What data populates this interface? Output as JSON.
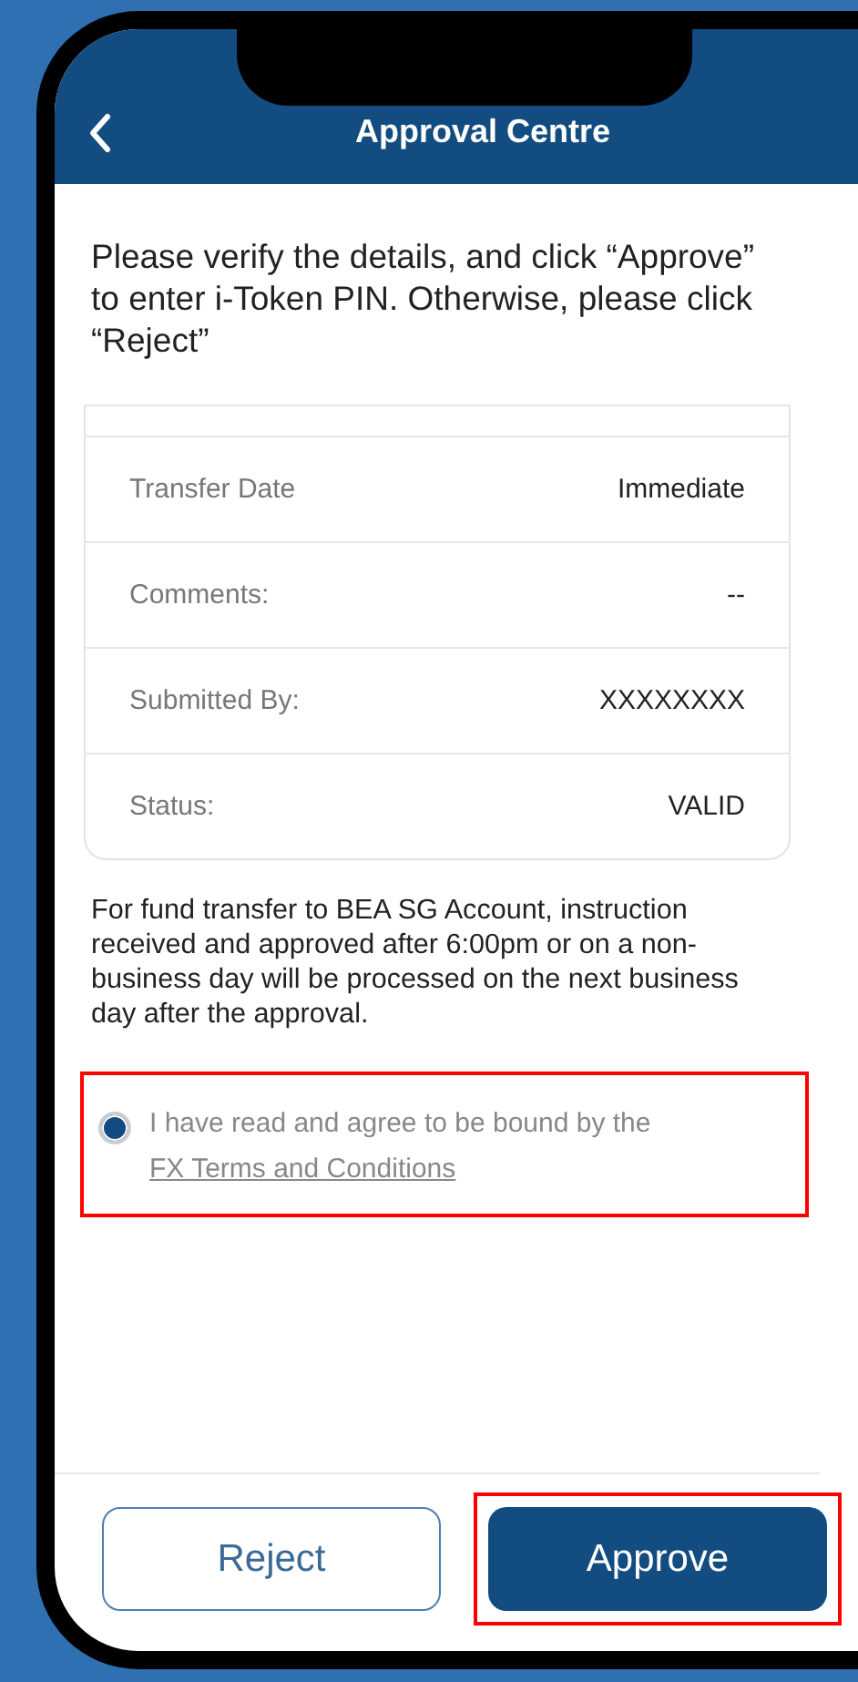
{
  "header": {
    "title": "Approval Centre"
  },
  "instruction": "Please verify the details, and click “Approve” to enter i-Token PIN. Otherwise, please click “Reject”",
  "details": [
    {
      "label": "Transfer Date",
      "value": "Immediate"
    },
    {
      "label": "Comments:",
      "value": "--"
    },
    {
      "label": "Submitted By:",
      "value": "XXXXXXXX"
    },
    {
      "label": "Status:",
      "value": "VALID"
    }
  ],
  "notice": "For fund transfer to BEA SG Account, instruction received and approved after 6:00pm or on a non-business day will be processed on the next business day after the approval.",
  "agreement": {
    "checked": true,
    "text": "I have read and agree to be bound by the",
    "link": "FX Terms and Conditions",
    "highlighted": true
  },
  "buttons": [
    {
      "label": "Reject",
      "kind": "secondary",
      "highlighted": false
    },
    {
      "label": "Approve",
      "kind": "primary",
      "highlighted": true
    }
  ]
}
